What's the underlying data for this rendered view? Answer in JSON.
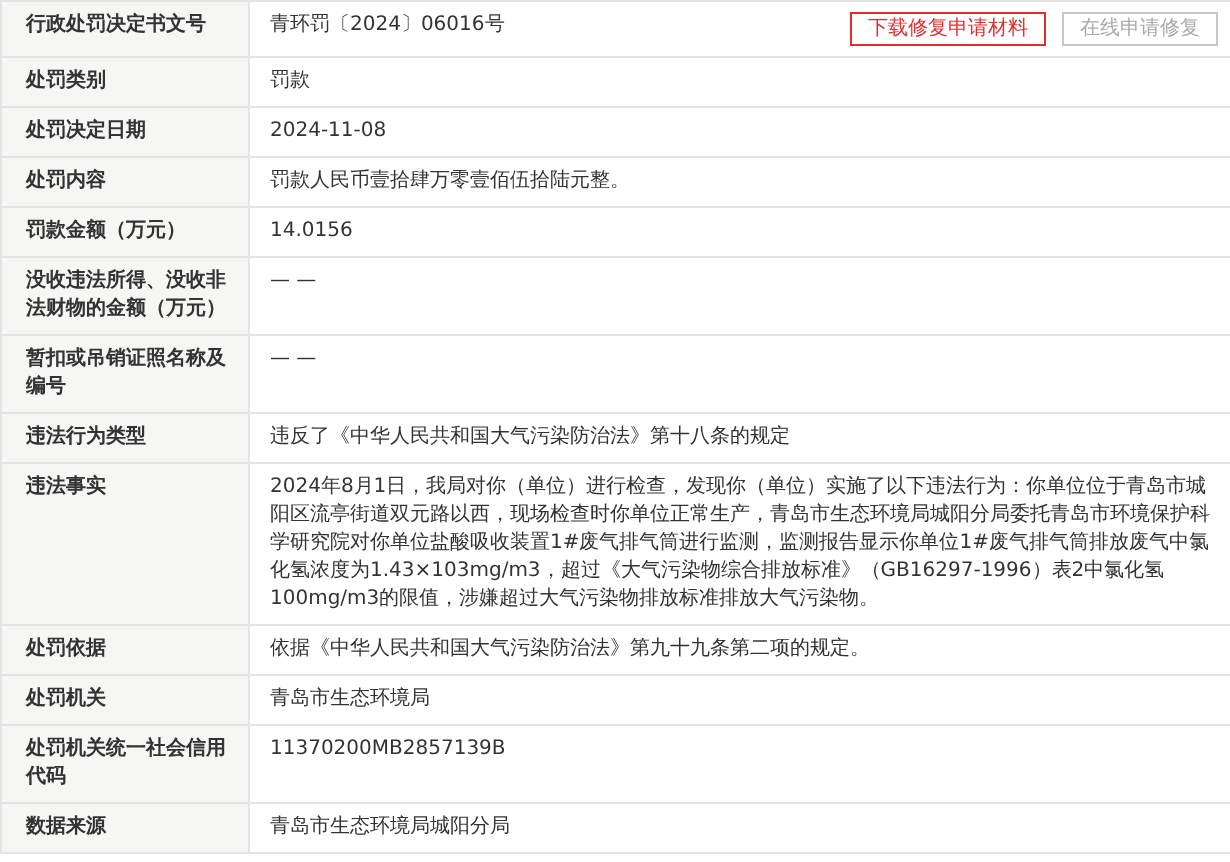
{
  "rows": [
    {
      "label": "行政处罚决定书文号",
      "value": "青环罚〔2024〕06016号",
      "buttons": [
        {
          "label": "下载修复申请材料",
          "disabled": false
        },
        {
          "label": "在线申请修复",
          "disabled": true
        }
      ]
    },
    {
      "label": "处罚类别",
      "value": "罚款"
    },
    {
      "label": "处罚决定日期",
      "value": "2024-11-08"
    },
    {
      "label": "处罚内容",
      "value": "罚款人民币壹拾肆万零壹佰伍拾陆元整。"
    },
    {
      "label": "罚款金额（万元）",
      "value": "14.0156"
    },
    {
      "label": "没收违法所得、没收非法财物的金额（万元）",
      "value": "— —"
    },
    {
      "label": "暂扣或吊销证照名称及编号",
      "value": "— —"
    },
    {
      "label": "违法行为类型",
      "value": "违反了《中华人民共和国大气污染防治法》第十八条的规定"
    },
    {
      "label": "违法事实",
      "value": "2024年8月1日，我局对你（单位）进行检查，发现你（单位）实施了以下违法行为：你单位位于青岛市城阳区流亭街道双元路以西，现场检查时你单位正常生产，青岛市生态环境局城阳分局委托青岛市环境保护科学研究院对你单位盐酸吸收装置1#废气排气筒进行监测，监测报告显示你单位1#废气排气筒排放废气中氯化氢浓度为1.43×103mg/m3，超过《大气污染物综合排放标准》（GB16297-1996）表2中氯化氢100mg/m3的限值，涉嫌超过大气污染物排放标准排放大气污染物。"
    },
    {
      "label": "处罚依据",
      "value": "依据《中华人民共和国大气污染防治法》第九十九条第二项的规定。"
    },
    {
      "label": "处罚机关",
      "value": "青岛市生态环境局"
    },
    {
      "label": "处罚机关统一社会信用代码",
      "value": "11370200MB2857139B"
    },
    {
      "label": "数据来源",
      "value": "青岛市生态环境局城阳分局"
    }
  ]
}
